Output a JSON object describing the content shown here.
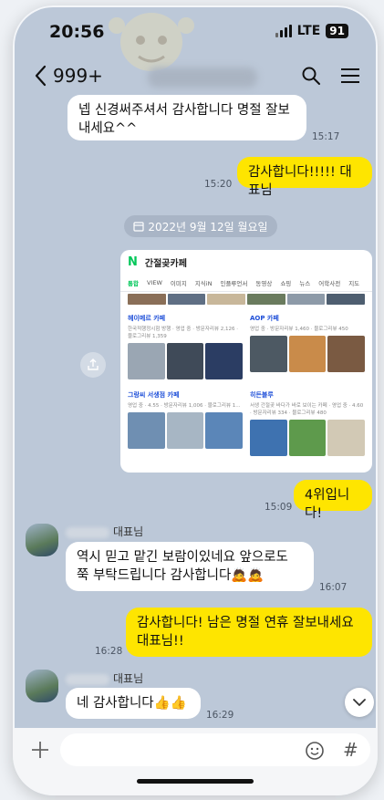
{
  "status": {
    "time": "20:56",
    "network": "LTE",
    "battery": "91"
  },
  "nav": {
    "back_count": "999+"
  },
  "messages": {
    "m1": {
      "text": "넵 신경써주셔서 감사합니다 명절 잘보내세요^^",
      "time": "15:17"
    },
    "m2": {
      "text": "감사합니다!!!!! 대표님",
      "time": "15:20"
    },
    "date_divider": "2022년 9월 12일 월요일",
    "m3": {
      "time": "15:09"
    },
    "m4": {
      "text": "4위입니다!",
      "time": "15:09"
    },
    "m5": {
      "sender_suffix": "대표님",
      "text": "역시 믿고 맡긴 보람이있네요 앞으로도 쭉 부탁드립니다 감사합니다🙇🙇",
      "time": "16:07"
    },
    "m6": {
      "text": "감사합니다! 남은 명절 연휴 잘보내세요 대표님!!",
      "time": "16:28"
    },
    "m7": {
      "sender_suffix": "대표님",
      "text": "네 감사합니다👍👍",
      "time": "16:29"
    }
  },
  "image_card": {
    "search_query": "간절곶카페",
    "tabs": [
      "통합",
      "VIEW",
      "이미지",
      "지식iN",
      "인플루언서",
      "동영상",
      "쇼핑",
      "뉴스",
      "어학사전",
      "지도"
    ],
    "places": [
      {
        "name": "헤이메르 카페",
        "sub": "한국적행정시험 방행 · 영업 중 · 방문자리뷰 2,126 · 블로그리뷰 1,359"
      },
      {
        "name": "AOP 카페",
        "sub": "영업 중 · 방문자리뷰 1,460 · 블로그리뷰 450"
      },
      {
        "name": "그랑씨 서생점 카페",
        "sub": "영업 중 · 4.55 · 방문자리뷰 1,006 · 블로그리뷰 1..."
      },
      {
        "name": "히든블루",
        "sub": "서생 간절곶 바다가 바로 보이는 카페 · 영업 중 · 4.60 · 방문자리뷰 334 · 블로그리뷰 480"
      }
    ]
  },
  "input": {
    "placeholder": ""
  },
  "colors": {
    "bg": "#bcc8d8",
    "bubble_out": "#fee500",
    "bubble_in": "#ffffff"
  }
}
